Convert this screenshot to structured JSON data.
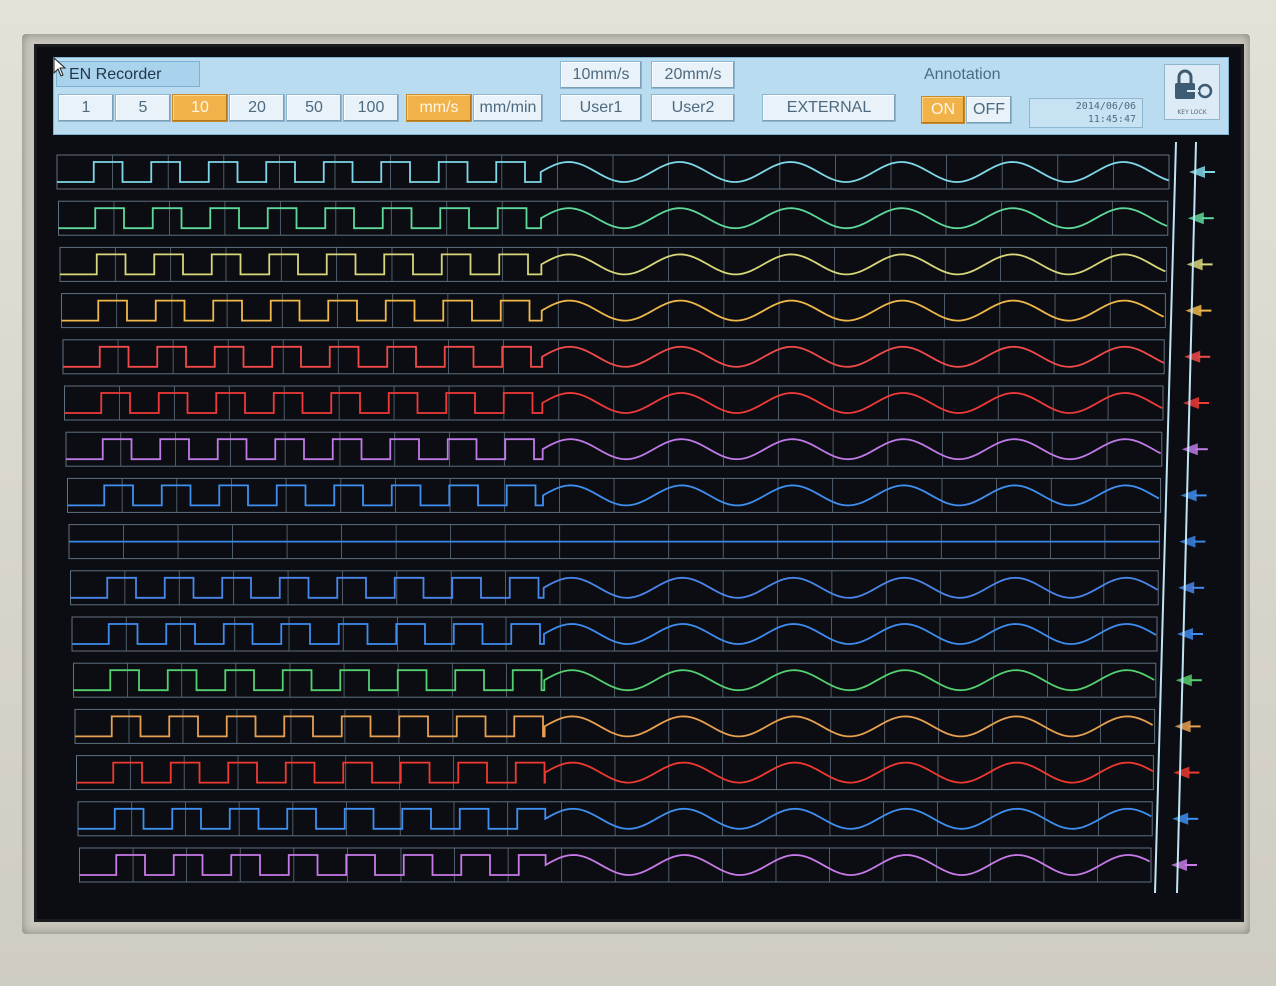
{
  "app": {
    "title": "EN Recorder"
  },
  "toolbar": {
    "speed_options": [
      "1",
      "5",
      "10",
      "20",
      "50",
      "100"
    ],
    "selected_speed": "10",
    "unit_options": [
      "mm/s",
      "mm/min"
    ],
    "selected_unit": "mm/s",
    "preset_10": "10mm/s",
    "preset_20": "20mm/s",
    "user1": "User1",
    "user2": "User2",
    "external": "EXTERNAL",
    "annotation_label": "Annotation",
    "annotation_on": "ON",
    "annotation_off": "OFF",
    "annotation_state": "ON",
    "date": "2014/06/06",
    "time": "11:45:47",
    "keylock_label": "KEY LOCK"
  },
  "channels": [
    {
      "color": "#7fd8e8"
    },
    {
      "color": "#5fd99a"
    },
    {
      "color": "#d8d77a"
    },
    {
      "color": "#f0b84a"
    },
    {
      "color": "#f04a4a"
    },
    {
      "color": "#f03a3a"
    },
    {
      "color": "#c07ae8"
    },
    {
      "color": "#3f8ff0"
    },
    {
      "color": "#3a86e8",
      "flat": true
    },
    {
      "color": "#4a86ea"
    },
    {
      "color": "#3f8cf0"
    },
    {
      "color": "#55d070"
    },
    {
      "color": "#e8a050"
    },
    {
      "color": "#f03a30"
    },
    {
      "color": "#3f8ff0"
    },
    {
      "color": "#c87ae8"
    }
  ],
  "colors": {
    "screen_bg": "#0b0d12",
    "grid": "#5f7080",
    "toolbar_bg": "#b9dcf0",
    "active_button": "#f2b24a",
    "cursor_line": "#bfe4f5"
  }
}
